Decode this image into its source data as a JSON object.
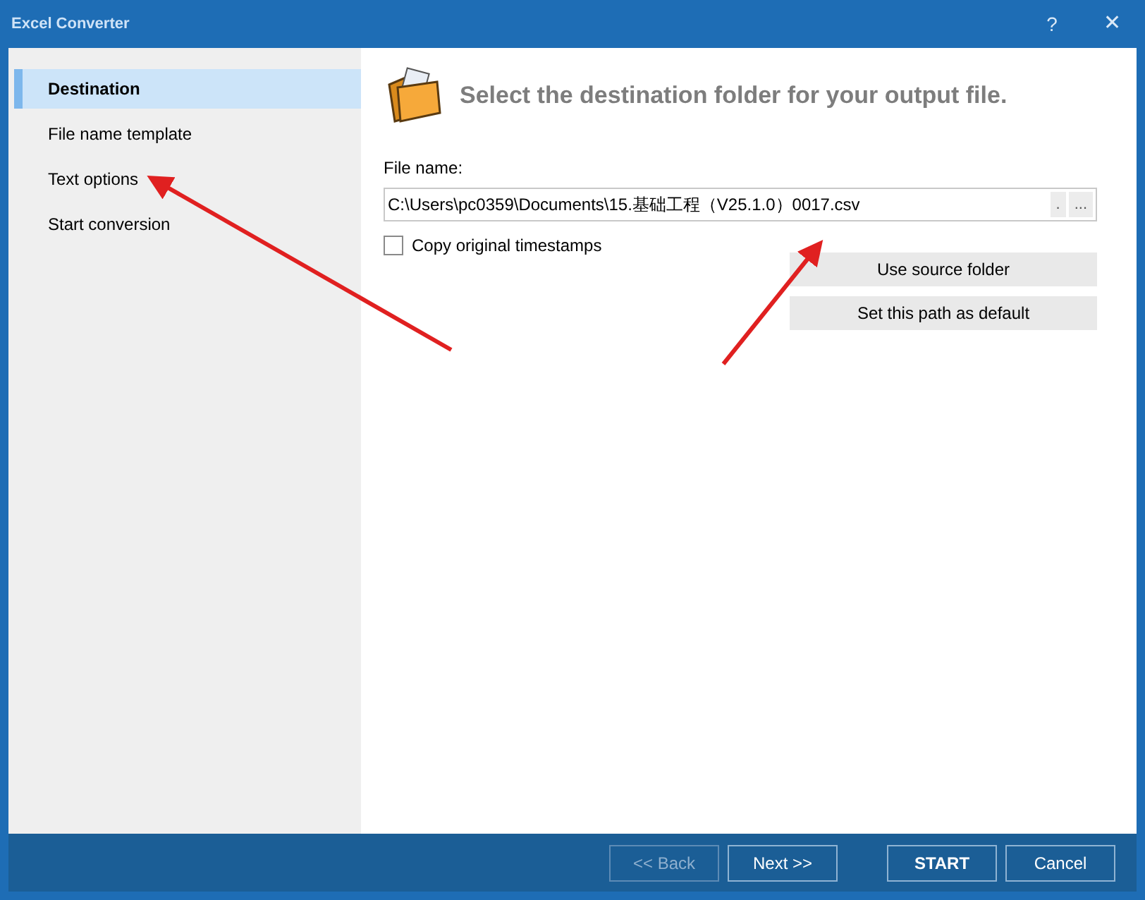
{
  "window": {
    "title": "Excel Converter",
    "help": "?",
    "close": "✕"
  },
  "sidebar": {
    "items": [
      {
        "label": "Destination",
        "selected": true
      },
      {
        "label": "File name template",
        "selected": false
      },
      {
        "label": "Text options",
        "selected": false
      },
      {
        "label": "Start conversion",
        "selected": false
      }
    ]
  },
  "header": "Select the destination folder for your output file.",
  "file_name": {
    "label": "File name:",
    "value": "C:\\Users\\pc0359\\Documents\\15.基础工程（V25.1.0）0017.csv",
    "buttons": [
      ".",
      "..."
    ]
  },
  "copy_timestamps": {
    "label": "Copy original timestamps",
    "checked": false
  },
  "path_buttons": [
    "Use source folder",
    "Set this path as default"
  ],
  "footer": {
    "buttons": [
      {
        "label": "<< Back",
        "disabled": true,
        "kind": "nav"
      },
      {
        "label": "Next >>",
        "disabled": false,
        "kind": "nav"
      },
      {
        "label": "START",
        "disabled": false,
        "kind": "primary"
      },
      {
        "label": "Cancel",
        "disabled": false,
        "kind": "nav"
      }
    ]
  }
}
